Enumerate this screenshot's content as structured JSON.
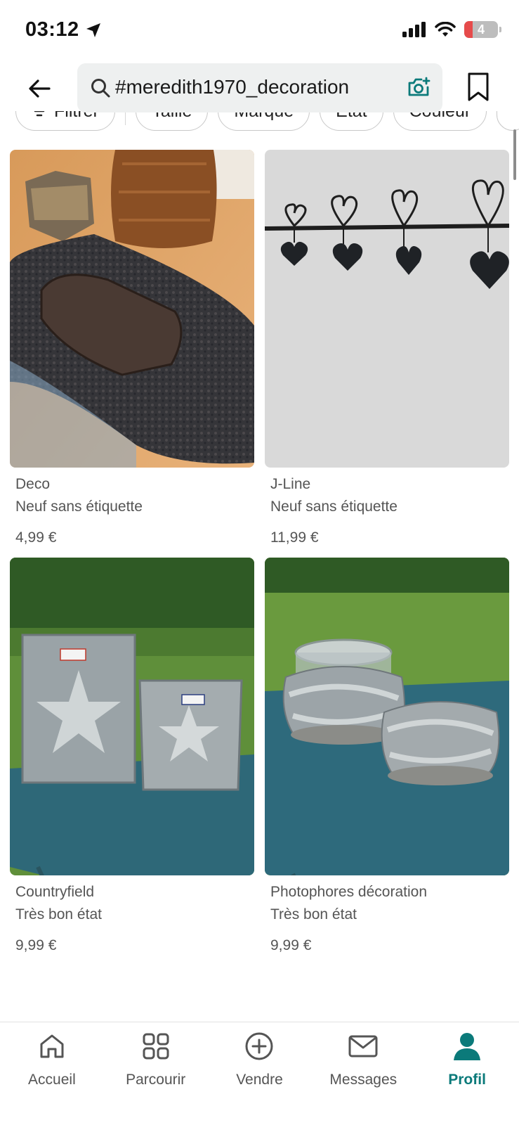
{
  "status_bar": {
    "time": "03:12",
    "battery": "4"
  },
  "search": {
    "query": "#meredith1970_decoration"
  },
  "filters": [
    "Filtrer",
    "Taille",
    "Marque",
    "État",
    "Couleur"
  ],
  "items": [
    {
      "brand": "Deco",
      "condition": "Neuf sans étiquette",
      "price": "4,99 €"
    },
    {
      "brand": "J-Line",
      "condition": "Neuf sans étiquette",
      "price": "11,99 €"
    },
    {
      "brand": "Countryfield",
      "condition": "Très bon état",
      "price": "9,99 €"
    },
    {
      "brand": "Photophores décoration",
      "condition": "Très bon état",
      "price": "9,99 €"
    }
  ],
  "nav": {
    "home": "Accueil",
    "browse": "Parcourir",
    "sell": "Vendre",
    "messages": "Messages",
    "profile": "Profil"
  },
  "colors": {
    "accent": "#0b7a7a"
  }
}
